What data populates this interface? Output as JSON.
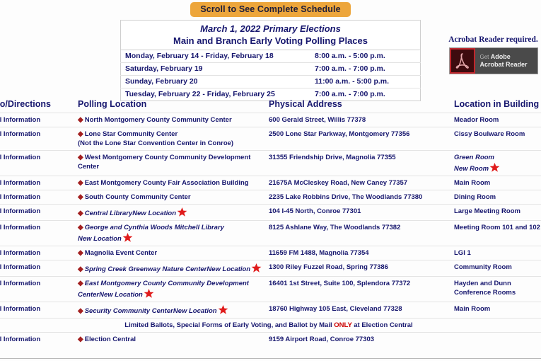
{
  "banner": {
    "scroll_label": "Scroll to See Complete Schedule"
  },
  "schedule": {
    "title_line1": "March 1, 2022 Primary Elections",
    "title_line2": "Main and Branch Early Voting Polling Places",
    "rows": [
      {
        "days": "Monday, February 14 - Friday, February 18",
        "hours": "8:00 a.m. - 5:00 p.m."
      },
      {
        "days": "Saturday, February 19",
        "hours": "7:00 a.m. - 7:00 p.m."
      },
      {
        "days": "Sunday, February 20",
        "hours": "11:00 a.m. - 5:00 p.m."
      },
      {
        "days": "Tuesday, February 22 - Friday, February 25",
        "hours": "7:00 a.m. - 7:00 p.m."
      }
    ]
  },
  "acrobat": {
    "note": "Acrobat Reader required.",
    "badge_get": "Get",
    "badge_adobe": "Adobe",
    "badge_product": "Acrobat Reader"
  },
  "table": {
    "headers": {
      "info": "Photo/Directions",
      "location": "Polling Location",
      "address": "Physical Address",
      "room": "Location in Building"
    },
    "info_link_label": "Get All Information",
    "new_location_label": "New Location",
    "rows": [
      {
        "location": "North Montgomery County Community Center",
        "sub": "",
        "italic": false,
        "new_location": false,
        "address": "600 Gerald Street, Willis 77378",
        "room": "Meador Room",
        "room_italic": false,
        "room_extra": "",
        "room_extra_star": false
      },
      {
        "location": "Lone Star Community Center",
        "sub": "(Not the Lone Star Convention Center in Conroe)",
        "italic": false,
        "new_location": false,
        "address": "2500 Lone Star Parkway, Montgomery 77356",
        "room": "Cissy Boulware Room",
        "room_italic": false,
        "room_extra": "",
        "room_extra_star": false
      },
      {
        "location": "West Montgomery County Community Development Center",
        "sub": "",
        "italic": false,
        "new_location": false,
        "address": "31355 Friendship Drive, Magnolia 77355",
        "room": "Green Room",
        "room_italic": true,
        "room_extra": "New Room",
        "room_extra_star": true
      },
      {
        "location": "East Montgomery County Fair Association Building",
        "sub": "",
        "italic": false,
        "new_location": false,
        "address": "21675A McCleskey Road, New Caney 77357",
        "room": "Main Room",
        "room_italic": false,
        "room_extra": "",
        "room_extra_star": false
      },
      {
        "location": "South County Community Center",
        "sub": "",
        "italic": false,
        "new_location": false,
        "address": "2235 Lake Robbins Drive, The Woodlands 77380",
        "room": "Dining Room",
        "room_italic": false,
        "room_extra": "",
        "room_extra_star": false
      },
      {
        "location": "Central Library",
        "sub": "",
        "italic": true,
        "new_location": true,
        "address": "104 I-45 North, Conroe 77301",
        "room": "Large Meeting Room",
        "room_italic": false,
        "room_extra": "",
        "room_extra_star": false
      },
      {
        "location": "George and Cynthia Woods Mitchell Library",
        "sub": "",
        "italic": true,
        "new_location": true,
        "address": "8125 Ashlane Way, The Woodlands 77382",
        "room": "Meeting Room 101 and 102",
        "room_italic": false,
        "room_extra": "",
        "room_extra_star": false
      },
      {
        "location": "Magnolia Event Center",
        "sub": "",
        "italic": false,
        "new_location": false,
        "address": "11659 FM 1488, Magnolia 77354",
        "room": "LGI 1",
        "room_italic": false,
        "room_extra": "",
        "room_extra_star": false
      },
      {
        "location": "Spring Creek Greenway Nature Center",
        "sub": "",
        "italic": true,
        "new_location": true,
        "address": "1300 Riley Fuzzel Road, Spring 77386",
        "room": "Community Room",
        "room_italic": false,
        "room_extra": "",
        "room_extra_star": false
      },
      {
        "location": "East Montgomery County Community Development Center",
        "sub": "",
        "italic": true,
        "new_location": true,
        "address": "16401 1st Street, Suite 100, Splendora 77372",
        "room": "Hayden and Dunn",
        "room_italic": false,
        "room_extra": "Conference Rooms",
        "room_extra_star": false
      },
      {
        "location": "Security Community Center",
        "sub": "",
        "italic": true,
        "new_location": true,
        "address": "18760 Highway 105 East, Cleveland 77328",
        "room": "Main Room",
        "room_italic": false,
        "room_extra": "",
        "room_extra_star": false
      }
    ],
    "limited_ballots": {
      "text_before": "Limited Ballots, Special Forms of Early Voting, and Ballot by Mail ",
      "only": "ONLY",
      "text_after": " at Election Central"
    },
    "final_row": {
      "location": "Election Central",
      "address": "9159 Airport Road, Conroe 77303",
      "room": ""
    }
  }
}
